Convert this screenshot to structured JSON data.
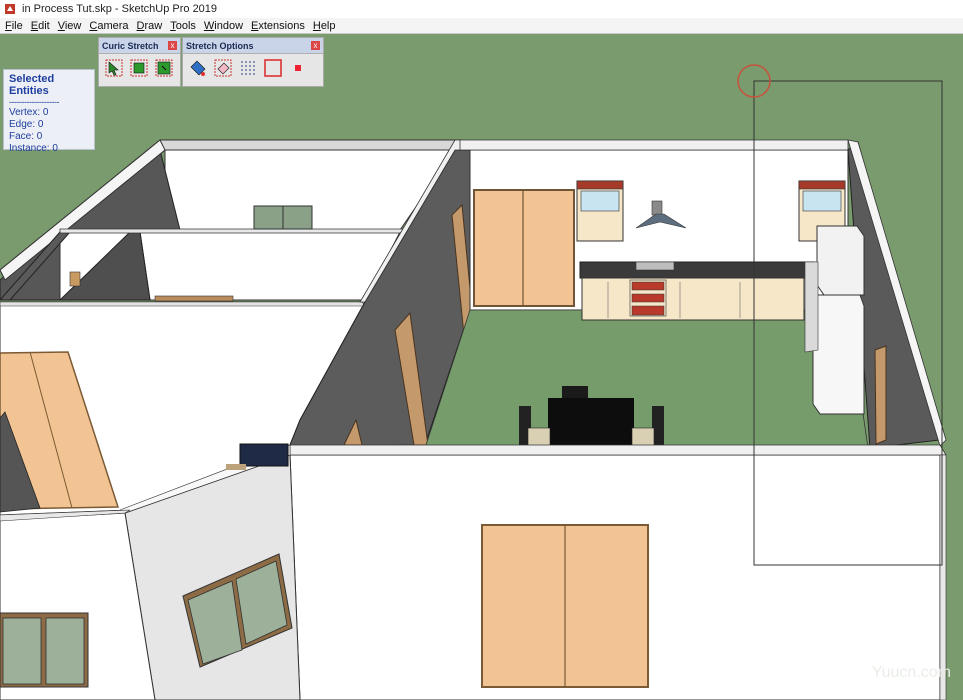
{
  "window": {
    "title": "in Process Tut.skp - SketchUp Pro 2019"
  },
  "menu": [
    "File",
    "Edit",
    "View",
    "Camera",
    "Draw",
    "Tools",
    "Window",
    "Extensions",
    "Help"
  ],
  "selected_entities": {
    "title": "Selected Entities",
    "divider": "--------------------",
    "vertex": "Vertex: 0",
    "edge": "Edge: 0",
    "face": "Face: 0",
    "instance": "Instance: 0"
  },
  "toolbar_curic": {
    "title": "Curic Stretch",
    "close": "x"
  },
  "toolbar_stretch": {
    "title": "Stretch Options",
    "close": "x"
  },
  "watermark": "Yuucn.com",
  "colors": {
    "ground": "#799b6d",
    "wall": "#ffffff",
    "door": "#f2c494",
    "floor": "#779c6b"
  }
}
